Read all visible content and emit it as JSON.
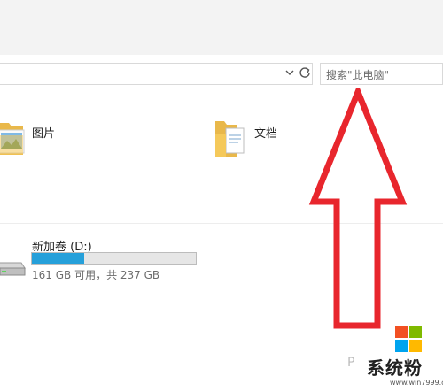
{
  "search": {
    "placeholder": "搜索\"此电脑\""
  },
  "folders": [
    {
      "label": "图片",
      "icon": "pictures-folder-icon"
    },
    {
      "label": "文档",
      "icon": "documents-folder-icon"
    }
  ],
  "drive": {
    "name": "新加卷 (D:)",
    "free_text": "161 GB 可用，共 237 GB",
    "used_fraction": 0.32,
    "fill_color": "#26a0da"
  },
  "watermark": {
    "brand": "系统粉",
    "site": "www.win7999.com",
    "corner_char": "P"
  },
  "colors": {
    "arrow": "#e8262d",
    "accent": "#26a0da"
  }
}
